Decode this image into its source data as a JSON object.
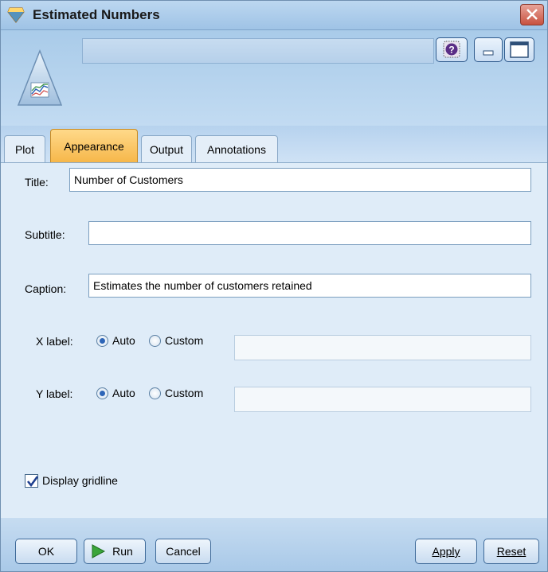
{
  "window": {
    "title": "Estimated Numbers",
    "accent": "#f6b74a"
  },
  "icons": {
    "title": "node-diamond-icon",
    "node": "multiplot-node-icon",
    "help": "help-icon",
    "close": "close-icon",
    "minimize": "minimize-icon",
    "maximize": "maximize-icon",
    "run": "play-icon"
  },
  "tabs": [
    {
      "label": "Plot"
    },
    {
      "label": "Appearance"
    },
    {
      "label": "Output"
    },
    {
      "label": "Annotations"
    }
  ],
  "appearance": {
    "title_label": "Title:",
    "title_value": "Number of Customers",
    "subtitle_label": "Subtitle:",
    "subtitle_value": "",
    "caption_label": "Caption:",
    "caption_value": "Estimates the number of customers retained",
    "xlabel_label": "X label:",
    "ylabel_label": "Y label:",
    "auto_label": "Auto",
    "custom_label": "Custom",
    "x_selected": "Auto",
    "y_selected": "Auto",
    "gridline_label": "Display gridline",
    "gridline_checked": true
  },
  "footer": {
    "ok": "OK",
    "run": "Run",
    "cancel": "Cancel",
    "apply": "Apply",
    "reset": "Reset"
  }
}
